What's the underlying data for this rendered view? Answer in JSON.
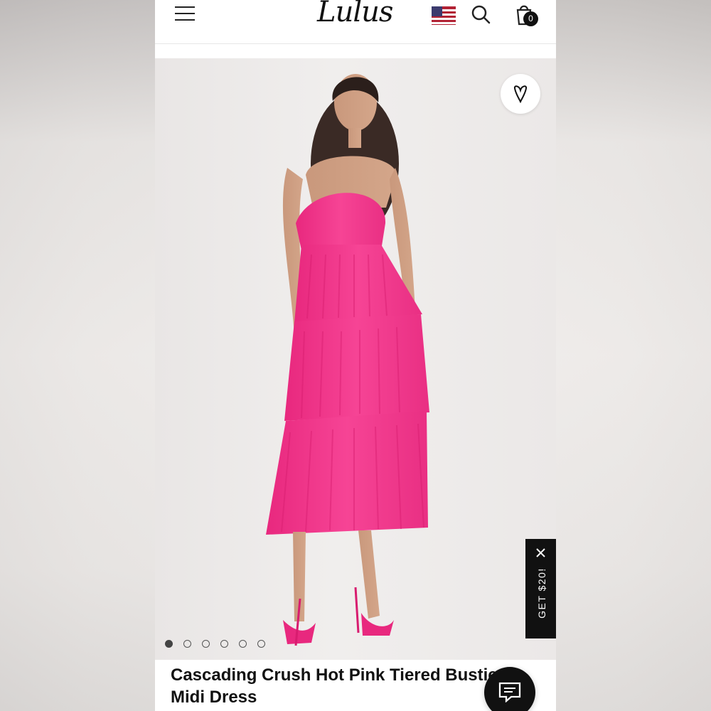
{
  "header": {
    "logo": "Lulus",
    "cart_count": "0",
    "icons": {
      "menu": "hamburger-menu-icon",
      "flag": "us-flag-icon",
      "search": "search-icon",
      "cart": "shopping-bag-icon"
    }
  },
  "hero": {
    "slides_count": 6,
    "active_slide": 1,
    "wish_icon": "heart-icon"
  },
  "promo": {
    "label": "GET $20!",
    "close_icon": "close-icon"
  },
  "product": {
    "title": "Cascading Crush Hot Pink Tiered Bustier Midi Dress"
  },
  "chat": {
    "icon": "chat-icon"
  },
  "colors": {
    "dress": "#f43c8f",
    "promo_bg": "#111111",
    "text": "#111111"
  }
}
